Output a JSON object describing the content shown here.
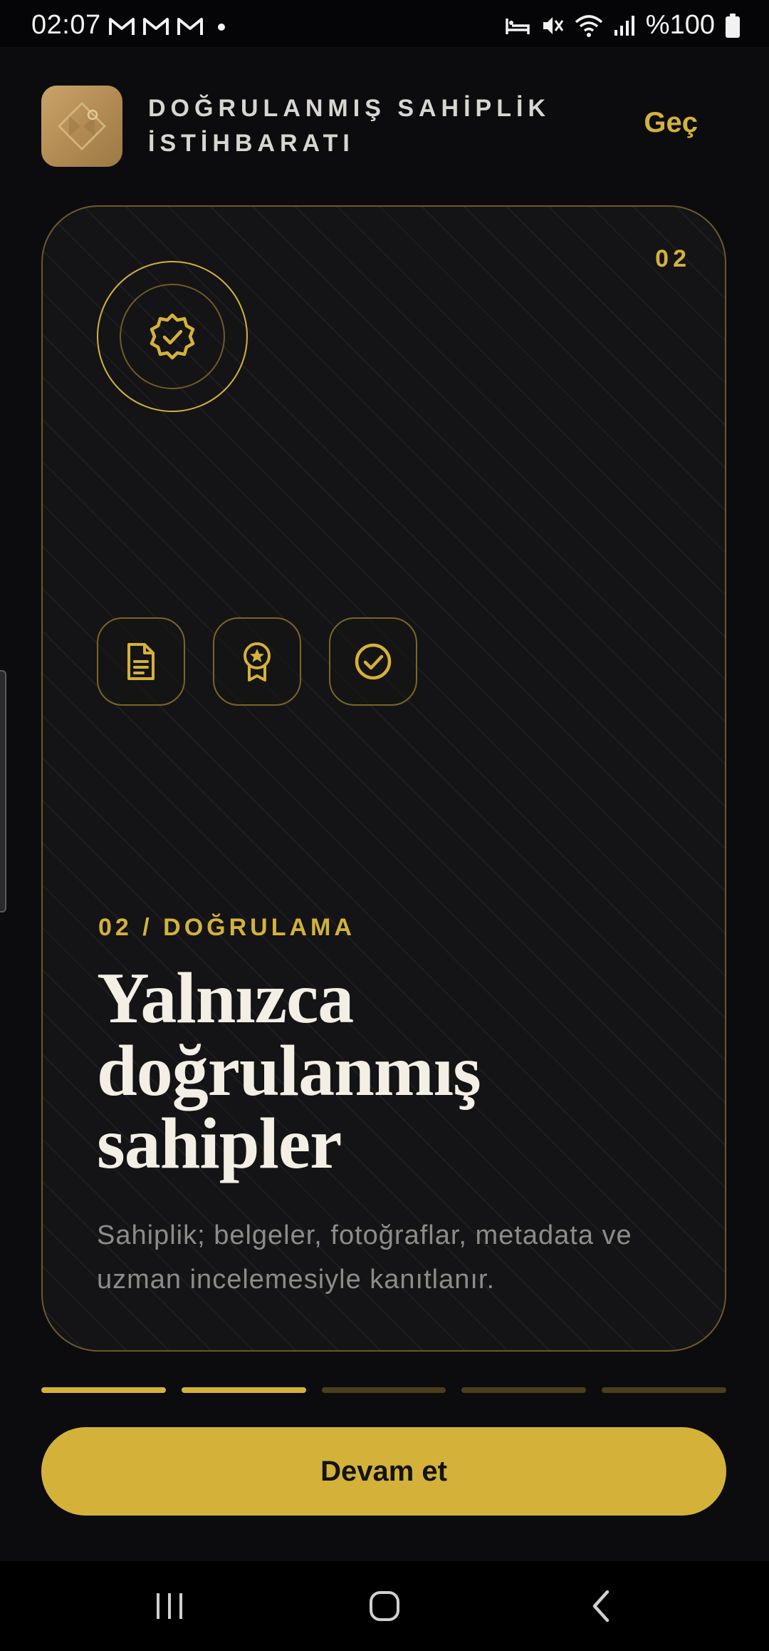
{
  "status_bar": {
    "time": "02:07",
    "battery": "%100",
    "icons": [
      "gmail-icon",
      "gmail-icon",
      "gmail-icon",
      "notification-dot",
      "sleep-icon",
      "mute-icon",
      "wifi-icon",
      "signal-icon",
      "battery-icon"
    ]
  },
  "header": {
    "logo_icon": "diamond-logo-icon",
    "title": "DOĞRULANMIŞ SAHİPLİK İSTİHBARATI",
    "skip_label": "Geç"
  },
  "card": {
    "step": "02",
    "badge_icon": "verified-badge-icon",
    "chips": [
      {
        "icon": "document-icon"
      },
      {
        "icon": "award-icon"
      },
      {
        "icon": "check-circle-icon"
      }
    ],
    "kicker": "02 / DOĞRULAMA",
    "title": "Yalnızca doğrulanmış sahipler",
    "description": "Sahiplik; belgeler, fotoğraflar, metadata ve uzman incelemesiyle kanıtlanır."
  },
  "progress": {
    "total": 5,
    "completed": 2
  },
  "cta": {
    "label": "Devam et"
  },
  "colors": {
    "accent": "#d4b23a",
    "background": "#0c0c0e",
    "card": "#141416",
    "title": "#f3efe4",
    "muted": "#8e8c88"
  }
}
